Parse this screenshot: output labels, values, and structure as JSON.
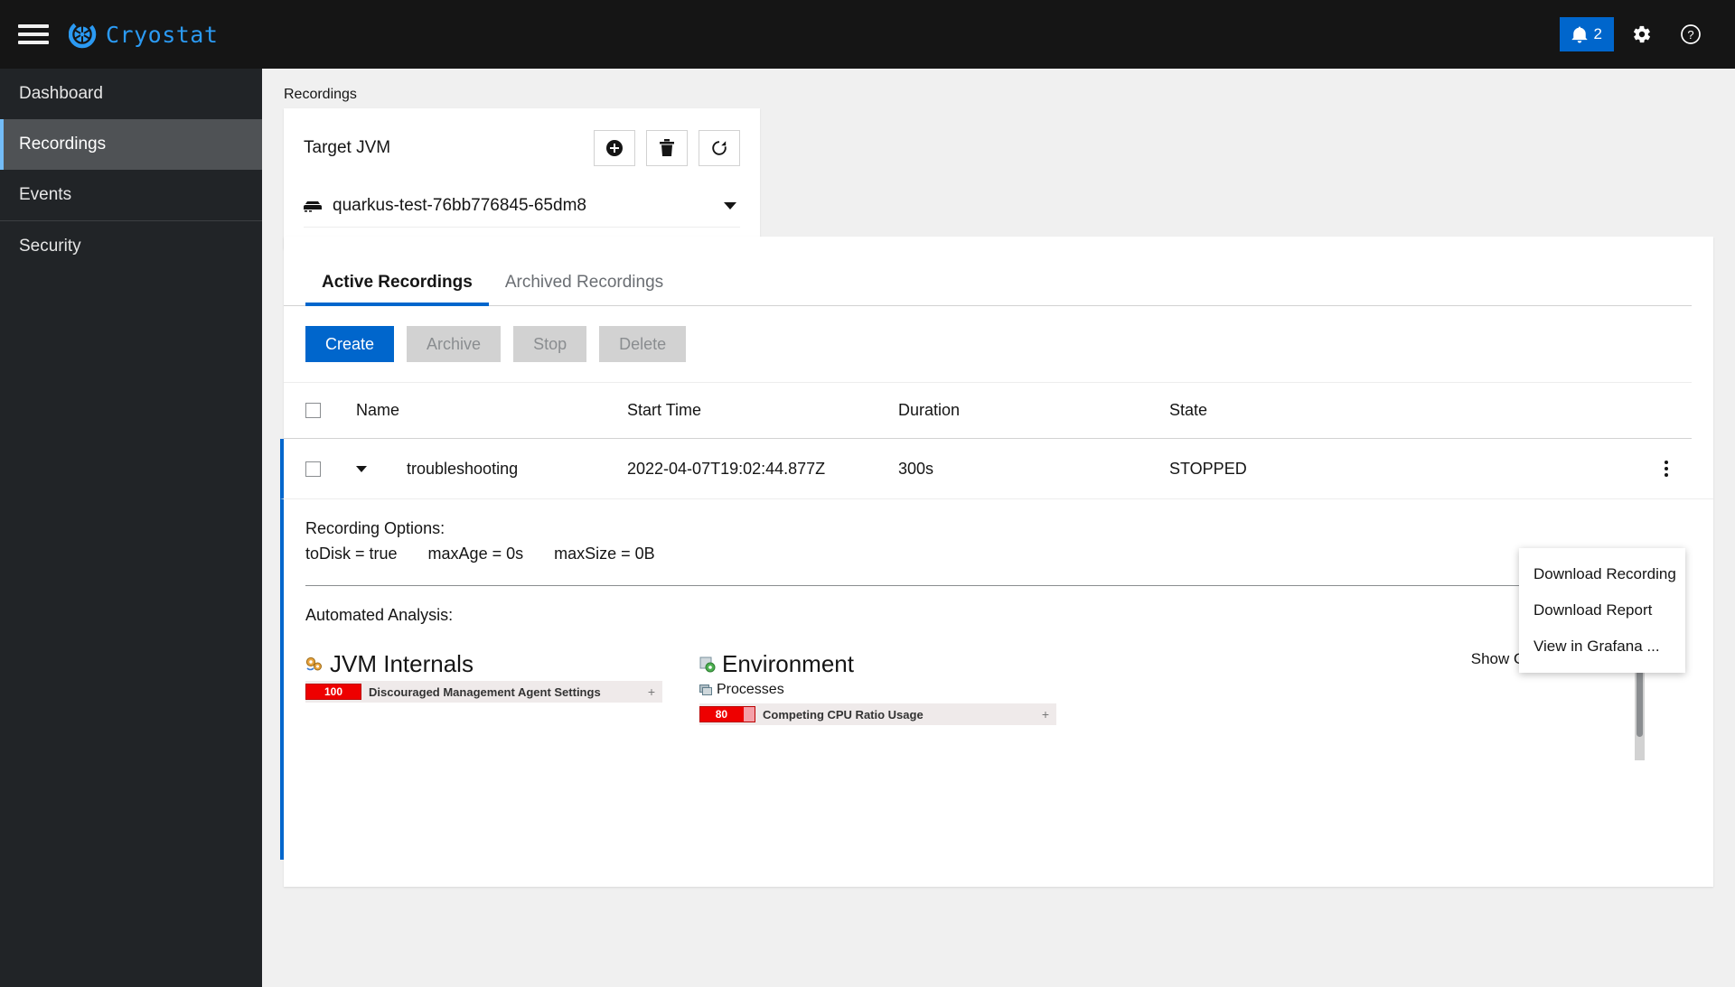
{
  "masthead": {
    "brand_name": "Cryostat",
    "menu_icon": "hamburger-icon",
    "notifications": {
      "icon": "bell-icon",
      "count": "2"
    },
    "settings_icon": "gear-icon",
    "help_icon": "help-circle-icon"
  },
  "sidebar": {
    "items": [
      {
        "label": "Dashboard",
        "active": false
      },
      {
        "label": "Recordings",
        "active": true
      },
      {
        "label": "Events",
        "active": false
      },
      {
        "label": "Security",
        "active": false
      }
    ]
  },
  "main": {
    "section_label": "Recordings",
    "target_card": {
      "title": "Target JVM",
      "actions": [
        {
          "name": "create-target-button",
          "icon": "plus-circle-icon"
        },
        {
          "name": "delete-target-button",
          "icon": "trash-icon"
        },
        {
          "name": "refresh-targets-button",
          "icon": "refresh-icon"
        }
      ],
      "selected_target": "quarkus-test-76bb776845-65dm8",
      "target_icon": "server-icon",
      "caret_icon": "caret-down-icon"
    },
    "tabs": [
      {
        "label": "Active Recordings",
        "active": true
      },
      {
        "label": "Archived Recordings",
        "active": false
      }
    ],
    "toolbar": {
      "create_label": "Create",
      "archive_label": "Archive",
      "stop_label": "Stop",
      "delete_label": "Delete"
    },
    "table": {
      "columns": [
        "Name",
        "Start Time",
        "Duration",
        "State"
      ],
      "rows": [
        {
          "name": "troubleshooting",
          "start_time": "2022-04-07T19:02:44.877Z",
          "duration": "300s",
          "state": "STOPPED",
          "expanded": true
        }
      ]
    },
    "detail": {
      "options_title": "Recording Options:",
      "options": [
        "toDisk = true",
        "maxAge = 0s",
        "maxSize = 0B"
      ],
      "analysis_title": "Automated Analysis:",
      "show_ok_label": "Show OK Results",
      "show_ok_checked": false,
      "categories": [
        {
          "name": "JVM Internals",
          "icon": "cogs-icon",
          "subcategories": [],
          "rules": [
            {
              "score": "100",
              "score_pct": 100,
              "name": "Discouraged Management Agent Settings",
              "expand": "+"
            }
          ]
        },
        {
          "name": "Environment",
          "icon": "environment-icon",
          "subcategories": [
            {
              "name": "Processes",
              "icon": "processes-icon",
              "rules": [
                {
                  "score": "80",
                  "score_pct": 80,
                  "name": "Competing CPU Ratio Usage",
                  "expand": "+"
                }
              ]
            }
          ],
          "rules": []
        }
      ]
    },
    "kebab_menu": {
      "items": [
        "Download Recording",
        "Download Report",
        "View in Grafana ..."
      ]
    }
  },
  "colors": {
    "accent_blue": "#0066cc",
    "brand_cyan": "#2b9af3",
    "masthead_bg": "#151515",
    "sidebar_bg": "#212427",
    "sidebar_active_bg": "#4f5255",
    "page_bg": "#f0f0f0",
    "score_red": "#e00000",
    "score_pink": "#f4a0a8"
  }
}
